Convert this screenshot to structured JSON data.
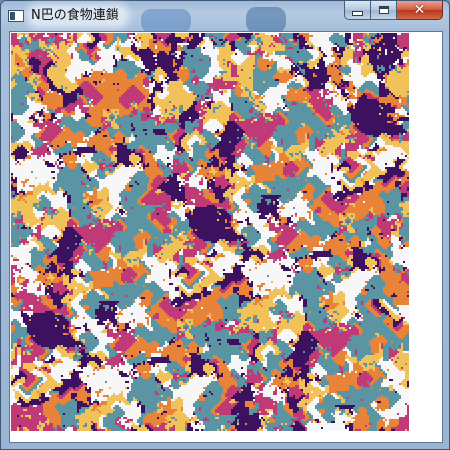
{
  "window": {
    "title": "N巴の食物連鎖",
    "buttons": {
      "minimize": "minimize-icon",
      "maximize": "maximize-icon",
      "close": "close-icon"
    }
  },
  "simulation": {
    "palette": [
      "#f7f7f7",
      "#5b94a2",
      "#e8833a",
      "#c03a78",
      "#3b1160",
      "#f2c25a",
      "#7a2f8f"
    ]
  }
}
